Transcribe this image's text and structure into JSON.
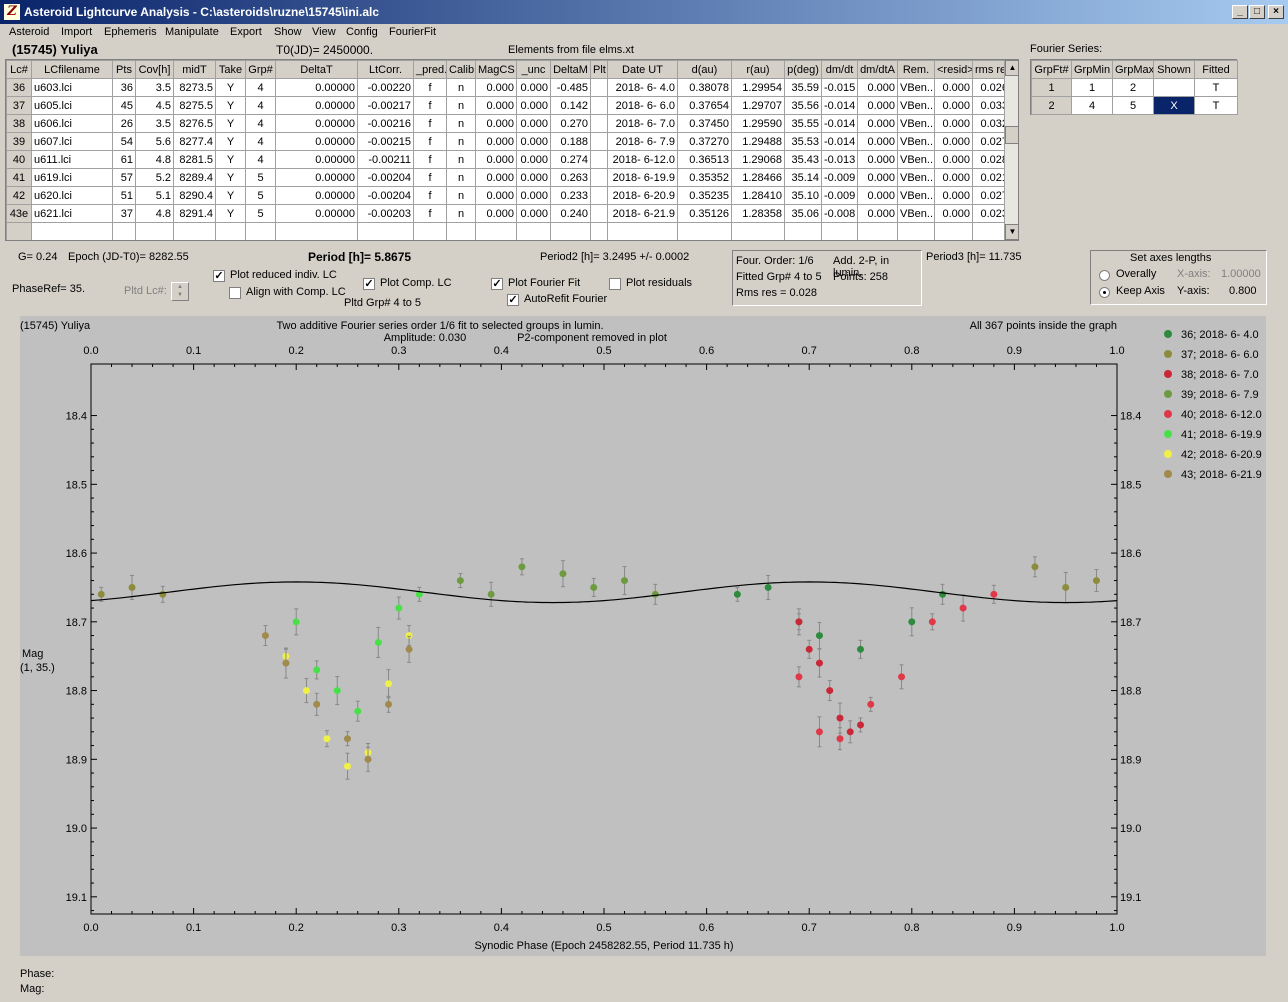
{
  "window": {
    "title": "Asteroid Lightcurve Analysis - C:\\asteroids\\ruzne\\15745\\ini.alc",
    "icon_glyph": "Z"
  },
  "menu": [
    "Asteroid",
    "Import",
    "Ephemeris",
    "Manipulate",
    "Export",
    "Show",
    "View",
    "Config",
    "FourierFit"
  ],
  "header": {
    "asteroid_name": "(15745) Yuliya",
    "t0": "T0(JD)= 2450000.",
    "elements": "Elements from file elms.xt"
  },
  "table": {
    "columns": [
      "Lc#",
      "LCfilename",
      "Pts",
      "Cov[h]",
      "midT",
      "Take",
      "Grp#",
      "DeltaT",
      "LtCorr.",
      "_pred.",
      "Calib.",
      "MagCS",
      "_unc",
      "DeltaM",
      "Plt",
      "Date UT",
      "d(au)",
      "r(au)",
      "p(deg)",
      "dm/dt",
      "dm/dtA",
      "Rem.",
      "<resid>",
      "rms res"
    ],
    "rows": [
      [
        "36",
        "u603.lci",
        "36",
        "3.5",
        "8273.5",
        "Y",
        "4",
        "0.00000",
        "-0.00220",
        "f",
        "n",
        "0.000",
        "0.000",
        "-0.485",
        "",
        "2018- 6- 4.0",
        "0.38078",
        "1.29954",
        "35.59",
        "-0.015",
        "0.000",
        "VBen..",
        "0.000",
        "0.026"
      ],
      [
        "37",
        "u605.lci",
        "45",
        "4.5",
        "8275.5",
        "Y",
        "4",
        "0.00000",
        "-0.00217",
        "f",
        "n",
        "0.000",
        "0.000",
        "0.142",
        "",
        "2018- 6- 6.0",
        "0.37654",
        "1.29707",
        "35.56",
        "-0.014",
        "0.000",
        "VBen..",
        "0.000",
        "0.033"
      ],
      [
        "38",
        "u606.lci",
        "26",
        "3.5",
        "8276.5",
        "Y",
        "4",
        "0.00000",
        "-0.00216",
        "f",
        "n",
        "0.000",
        "0.000",
        "0.270",
        "",
        "2018- 6- 7.0",
        "0.37450",
        "1.29590",
        "35.55",
        "-0.014",
        "0.000",
        "VBen..",
        "0.000",
        "0.032"
      ],
      [
        "39",
        "u607.lci",
        "54",
        "5.6",
        "8277.4",
        "Y",
        "4",
        "0.00000",
        "-0.00215",
        "f",
        "n",
        "0.000",
        "0.000",
        "0.188",
        "",
        "2018- 6- 7.9",
        "0.37270",
        "1.29488",
        "35.53",
        "-0.014",
        "0.000",
        "VBen..",
        "0.000",
        "0.027"
      ],
      [
        "40",
        "u611.lci",
        "61",
        "4.8",
        "8281.5",
        "Y",
        "4",
        "0.00000",
        "-0.00211",
        "f",
        "n",
        "0.000",
        "0.000",
        "0.274",
        "",
        "2018- 6-12.0",
        "0.36513",
        "1.29068",
        "35.43",
        "-0.013",
        "0.000",
        "VBen..",
        "0.000",
        "0.028"
      ],
      [
        "41",
        "u619.lci",
        "57",
        "5.2",
        "8289.4",
        "Y",
        "5",
        "0.00000",
        "-0.00204",
        "f",
        "n",
        "0.000",
        "0.000",
        "0.263",
        "",
        "2018- 6-19.9",
        "0.35352",
        "1.28466",
        "35.14",
        "-0.009",
        "0.000",
        "VBen..",
        "0.000",
        "0.021"
      ],
      [
        "42",
        "u620.lci",
        "51",
        "5.1",
        "8290.4",
        "Y",
        "5",
        "0.00000",
        "-0.00204",
        "f",
        "n",
        "0.000",
        "0.000",
        "0.233",
        "",
        "2018- 6-20.9",
        "0.35235",
        "1.28410",
        "35.10",
        "-0.009",
        "0.000",
        "VBen..",
        "0.000",
        "0.027"
      ],
      [
        "43e",
        "u621.lci",
        "37",
        "4.8",
        "8291.4",
        "Y",
        "5",
        "0.00000",
        "-0.00203",
        "f",
        "n",
        "0.000",
        "0.000",
        "0.240",
        "",
        "2018- 6-21.9",
        "0.35126",
        "1.28358",
        "35.06",
        "-0.008",
        "0.000",
        "VBen..",
        "0.000",
        "0.023"
      ]
    ]
  },
  "fourier_table": {
    "title": "Fourier Series:",
    "columns": [
      "GrpFt#",
      "GrpMin",
      "GrpMax",
      "Shown",
      "Fitted"
    ],
    "rows": [
      [
        "1",
        "1",
        "2",
        "",
        "T"
      ],
      [
        "2",
        "4",
        "5",
        "X",
        "T"
      ]
    ]
  },
  "info": {
    "g": "G= 0.24",
    "epoch": "Epoch (JD-T0)= 8282.55",
    "period": "Period [h]= 5.8675",
    "period2": "Period2 [h]= 3.2495 +/- 0.0002",
    "period3": "Period3 [h]= 11.735",
    "phaseref": "PhaseRef= 35.",
    "pltd_lc": "Pltd Lc#:",
    "pltd_grp": "Pltd Grp#  4  to  5"
  },
  "checks": [
    {
      "label": "Plot reduced indiv. LC",
      "checked": true
    },
    {
      "label": "Align with Comp. LC",
      "checked": false
    },
    {
      "label": "Plot Comp. LC",
      "checked": true
    },
    {
      "label": "Plot Fourier Fit",
      "checked": true
    },
    {
      "label": "Plot residuals",
      "checked": false
    },
    {
      "label": "AutoRefit Fourier",
      "checked": true
    }
  ],
  "fourier_info": {
    "order": "Four. Order:  1/6",
    "add": "Add. 2-P, in lumin.",
    "fitted": "Fitted Grp# 4 to 5",
    "points": "Points: 258",
    "rms": "Rms res      = 0.028"
  },
  "axes_box": {
    "title": "Set axes lengths",
    "overally": "Overally",
    "keep": "Keep Axis",
    "xaxis_label": "X-axis:",
    "xaxis_value": "1.00000",
    "yaxis_label": "Y-axis:",
    "yaxis_value": "0.800"
  },
  "status": {
    "phase": "Phase:",
    "mag": "Mag:"
  },
  "chart_data": {
    "type": "scatter",
    "title_left": "(15745) Yuliya",
    "title_center": "Two additive Fourier series order 1/6 fit to selected groups in lumin.",
    "amplitude": "Amplitude: 0.030",
    "p2note": "P2-component removed in plot",
    "title_right": "All 367 points inside the graph",
    "xlabel": "Synodic Phase (Epoch 2458282.55, Period 11.735 h)",
    "ylabel": "Mag",
    "ylabel2": "(1, 35.)",
    "xlim": [
      0,
      1
    ],
    "ylim": [
      18.6,
      19.18
    ],
    "y_inverted": true,
    "x_ticks": [
      "0.0",
      "0.1",
      "0.2",
      "0.3",
      "0.4",
      "0.5",
      "0.6",
      "0.7",
      "0.8",
      "0.9",
      "1.0"
    ],
    "y_ticks": [
      "18.4",
      "18.5",
      "18.6",
      "18.7",
      "18.8",
      "18.9",
      "19.0",
      "19.1"
    ],
    "fit_curve": {
      "mean": 18.657,
      "amplitude": 0.015
    },
    "series": [
      {
        "name": "36; 2018- 6- 4.0",
        "color": "#2e8b3e",
        "points": [
          [
            0.63,
            18.66
          ],
          [
            0.66,
            18.65
          ],
          [
            0.69,
            18.7
          ],
          [
            0.71,
            18.72
          ],
          [
            0.75,
            18.74
          ],
          [
            0.8,
            18.7
          ],
          [
            0.83,
            18.66
          ]
        ]
      },
      {
        "name": "37; 2018- 6- 6.0",
        "color": "#8c8c3c",
        "points": [
          [
            0.92,
            18.62
          ],
          [
            0.95,
            18.65
          ],
          [
            0.98,
            18.64
          ],
          [
            0.01,
            18.66
          ],
          [
            0.04,
            18.65
          ],
          [
            0.07,
            18.66
          ]
        ]
      },
      {
        "name": "38; 2018- 6- 7.0",
        "color": "#c82838",
        "points": [
          [
            0.69,
            18.7
          ],
          [
            0.7,
            18.74
          ],
          [
            0.71,
            18.76
          ],
          [
            0.72,
            18.8
          ],
          [
            0.73,
            18.84
          ],
          [
            0.74,
            18.86
          ],
          [
            0.75,
            18.85
          ]
        ]
      },
      {
        "name": "39; 2018- 6- 7.9",
        "color": "#6e9a40",
        "points": [
          [
            0.36,
            18.64
          ],
          [
            0.39,
            18.66
          ],
          [
            0.42,
            18.62
          ],
          [
            0.46,
            18.63
          ],
          [
            0.49,
            18.65
          ],
          [
            0.52,
            18.64
          ],
          [
            0.55,
            18.66
          ]
        ]
      },
      {
        "name": "40; 2018- 6-12.0",
        "color": "#e03848",
        "points": [
          [
            0.69,
            18.78
          ],
          [
            0.71,
            18.86
          ],
          [
            0.73,
            18.87
          ],
          [
            0.76,
            18.82
          ],
          [
            0.79,
            18.78
          ],
          [
            0.82,
            18.7
          ],
          [
            0.85,
            18.68
          ],
          [
            0.88,
            18.66
          ]
        ]
      },
      {
        "name": "41; 2018- 6-19.9",
        "color": "#48e048",
        "points": [
          [
            0.2,
            18.7
          ],
          [
            0.22,
            18.77
          ],
          [
            0.24,
            18.8
          ],
          [
            0.26,
            18.83
          ],
          [
            0.28,
            18.73
          ],
          [
            0.3,
            18.68
          ],
          [
            0.32,
            18.66
          ]
        ]
      },
      {
        "name": "42; 2018- 6-20.9",
        "color": "#f0f048",
        "points": [
          [
            0.19,
            18.75
          ],
          [
            0.21,
            18.8
          ],
          [
            0.23,
            18.87
          ],
          [
            0.25,
            18.91
          ],
          [
            0.27,
            18.89
          ],
          [
            0.29,
            18.79
          ],
          [
            0.31,
            18.72
          ]
        ]
      },
      {
        "name": "43; 2018- 6-21.9",
        "color": "#a08a4c",
        "points": [
          [
            0.17,
            18.72
          ],
          [
            0.19,
            18.76
          ],
          [
            0.22,
            18.82
          ],
          [
            0.25,
            18.87
          ],
          [
            0.27,
            18.9
          ],
          [
            0.29,
            18.82
          ],
          [
            0.31,
            18.74
          ]
        ]
      }
    ]
  }
}
